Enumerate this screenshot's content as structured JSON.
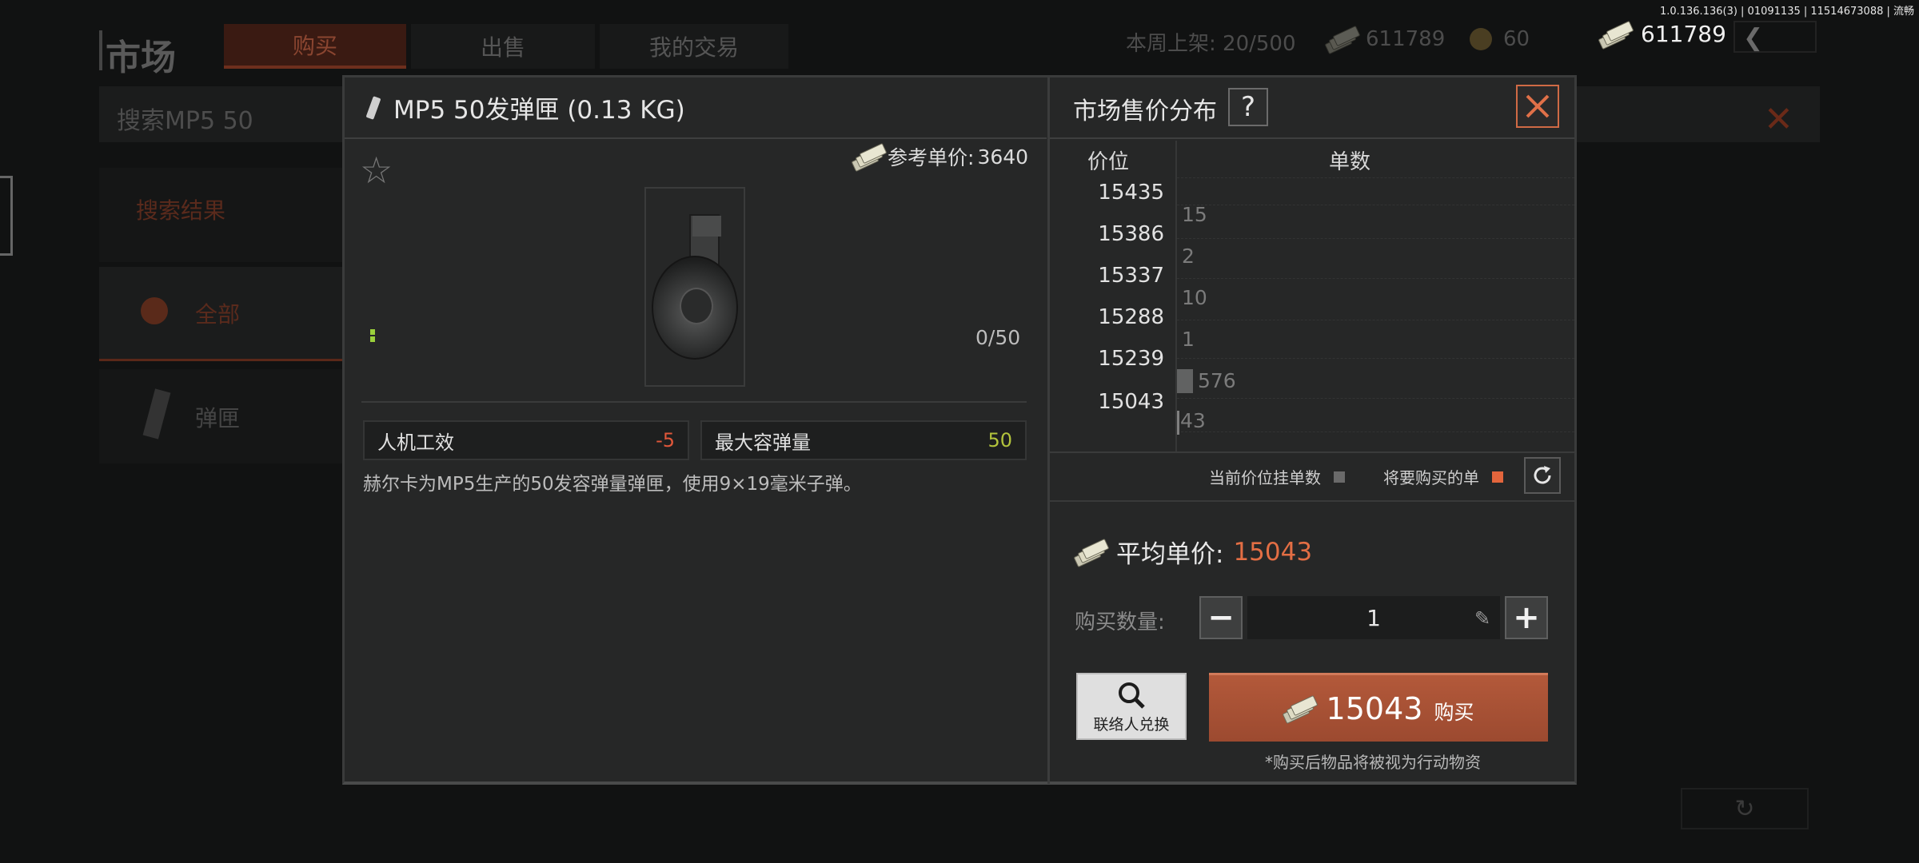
{
  "background": {
    "title": "市场",
    "tabs": [
      "购买",
      "出售",
      "我的交易"
    ],
    "weekly_listing": "本周上架: 20/500",
    "money": "611789",
    "coins": "60",
    "search_text": "搜索MP5 50",
    "search_results_label": "搜索结果",
    "side_items": [
      "全部",
      "弹匣"
    ]
  },
  "status": {
    "version": "1.0.136.136(3) | 01091135 | 11514673088 | 流畅",
    "money": "611789"
  },
  "item": {
    "title": "MP5 50发弹匣 (0.13 KG)",
    "ref_price_label": "参考单价:",
    "ref_price": "3640",
    "capacity_count": "0/50",
    "stats": [
      {
        "label": "人机工效",
        "value": "-5"
      },
      {
        "label": "最大容弹量",
        "value": "50"
      }
    ],
    "description": "赫尔卡为MP5生产的50发容弹量弹匣，使用9×19毫米子弹。"
  },
  "distribution": {
    "title": "市场售价分布",
    "help": "?",
    "col_price": "价位",
    "col_count": "单数",
    "rows": [
      {
        "price": "15435",
        "count": "15"
      },
      {
        "price": "15386",
        "count": "2"
      },
      {
        "price": "15337",
        "count": "10"
      },
      {
        "price": "15288",
        "count": "1"
      },
      {
        "price": "15239",
        "count": "576"
      },
      {
        "price": "15043",
        "count": "43"
      }
    ],
    "legend_current": "当前价位挂单数",
    "legend_buy": "将要购买的单",
    "legend_current_color": "#6a6a6a",
    "legend_buy_color": "#e3653c"
  },
  "purchase": {
    "avg_label": "平均单价:",
    "avg_price": "15043",
    "qty_label": "购买数量:",
    "qty_value": "1",
    "minus": "−",
    "plus": "+",
    "exchange_label": "联络人兑换",
    "buy_amount": "15043",
    "buy_label": "购买",
    "note": "*购买后物品将被视为行动物资"
  }
}
